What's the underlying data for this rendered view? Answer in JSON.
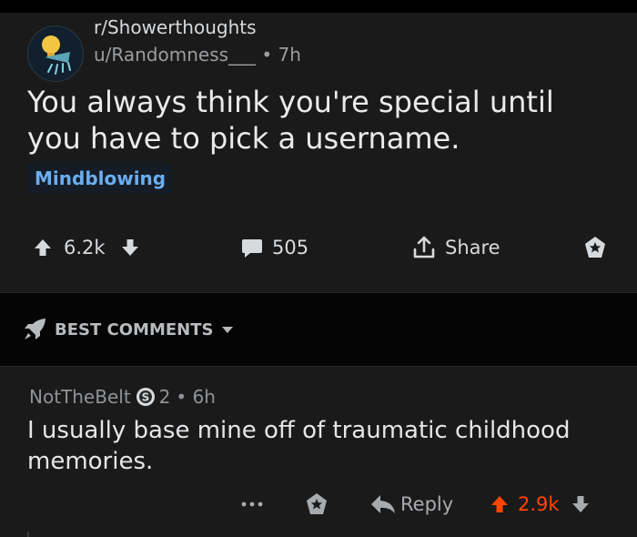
{
  "post": {
    "subreddit": "r/Showerthoughts",
    "author": "u/Randomness___",
    "age": "• 7h",
    "title": "You always think you're special until you have to pick a username.",
    "flair": "Mindblowing",
    "score": "6.2k",
    "comment_count": "505",
    "share_label": "Share",
    "icons": [
      "showerhead-avatar-icon",
      "upvote-icon",
      "downvote-icon",
      "comment-bubble-icon",
      "share-icon",
      "award-icon"
    ]
  },
  "sort": {
    "label": "BEST COMMENTS",
    "icons": [
      "rocket-icon",
      "caret-down-icon"
    ]
  },
  "comment": {
    "author": "NotTheBelt",
    "badge_count": "2",
    "age": "• 6h",
    "body": "I usually base mine off of traumatic childhood memories.",
    "reply_label": "Reply",
    "score": "2.9k",
    "icons": [
      "more-dots-icon",
      "award-icon",
      "reply-arrow-icon",
      "upvote-active-icon",
      "downvote-icon"
    ]
  },
  "colors": {
    "background": "#1a1a1b",
    "flair_text": "#6aaef0",
    "upvote_active": "#ff4500",
    "text": "#d7dadc"
  }
}
